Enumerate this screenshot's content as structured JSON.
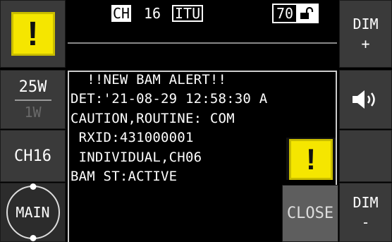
{
  "left_column": {
    "alert_icon_glyph": "!",
    "power_high": "25W",
    "power_low": "1W",
    "channel_quick": "CH16",
    "main_label": "MAIN"
  },
  "status_bar": {
    "ch_label": "CH",
    "channel_number": "16",
    "band_label": "ITU",
    "volume_level": "70",
    "lock_icon": "unlocked-padlock-icon"
  },
  "alert": {
    "lines": [
      "  !!NEW BAM ALERT!!",
      "DET:'21-08-29 12:58:30 A",
      "CAUTION,ROUTINE: COM",
      " RXID:431000001",
      " INDIVIDUAL,CH06",
      "BAM ST:ACTIVE"
    ],
    "mini_icon_glyph": "!",
    "close_label": "CLOSE"
  },
  "right_column": {
    "dim_up_label": "DIM",
    "dim_up_symbol": "+",
    "speaker_icon": "speaker-volume-icon",
    "dim_down_label": "DIM",
    "dim_down_symbol": "-"
  },
  "colors": {
    "alert_yellow": "#f5e600",
    "button_gray": "#3a3a3a",
    "close_gray": "#5e5e5e",
    "background": "#000000"
  }
}
